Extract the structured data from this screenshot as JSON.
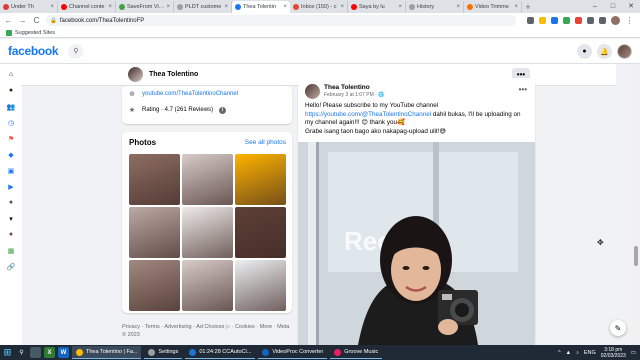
{
  "browser": {
    "tabs": [
      {
        "label": "Under Th",
        "color": "#e53935"
      },
      {
        "label": "Channel conte",
        "color": "#ff0000"
      },
      {
        "label": "SaveFrom Vide",
        "color": "#43a047"
      },
      {
        "label": "PLDT custome",
        "color": "#9e9e9e"
      },
      {
        "label": "Thea Tolentin",
        "color": "#1877f2",
        "active": true
      },
      {
        "label": "Inbox (150) - c",
        "color": "#ea4335"
      },
      {
        "label": "Saya by lu",
        "color": "#ff0000"
      },
      {
        "label": "History",
        "color": "#9e9e9e"
      },
      {
        "label": "Video Trimme",
        "color": "#ff6f00"
      }
    ],
    "tab_close": "×",
    "new_tab": "+",
    "win_min": "–",
    "win_max": "□",
    "win_close": "✕",
    "back": "←",
    "forward": "→",
    "reload": "C",
    "home": "⌂",
    "lock": "🔒",
    "url": "facebook.com/TheaTolentinoFP",
    "bookmark_label": "Suggested Sites"
  },
  "fb": {
    "logo": "facebook",
    "search_icon": "⚲",
    "messenger_icon": "●",
    "bell_icon": "🔔"
  },
  "rail_icons": [
    {
      "name": "home-icon",
      "glyph": "⌂",
      "color": "#050505"
    },
    {
      "name": "profile-icon",
      "glyph": "●",
      "color": "#3e2723"
    },
    {
      "name": "friends-icon",
      "glyph": "👥",
      "color": "#1877f2"
    },
    {
      "name": "memories-icon",
      "glyph": "◷",
      "color": "#1877f2"
    },
    {
      "name": "pages-icon",
      "glyph": "⚑",
      "color": "#f5533d"
    },
    {
      "name": "groups-icon",
      "glyph": "◆",
      "color": "#1877f2"
    },
    {
      "name": "gaming-icon",
      "glyph": "▣",
      "color": "#1877f2"
    },
    {
      "name": "watch-icon",
      "glyph": "▶",
      "color": "#1877f2"
    },
    {
      "name": "shortcut-icon",
      "glyph": "●",
      "color": "#455a64"
    },
    {
      "name": "more-icon",
      "glyph": "▾",
      "color": "#050505"
    },
    {
      "name": "shortcut-avatar-icon",
      "glyph": "●",
      "color": "#6d4c41"
    },
    {
      "name": "shortcut-photo-icon",
      "glyph": "▦",
      "color": "#43a047"
    },
    {
      "name": "link-icon",
      "glyph": "🔗",
      "color": "#65676b"
    }
  ],
  "profile": {
    "name": "Thea Tolentino",
    "more": "•••"
  },
  "intro": {
    "link_icon": "⊕",
    "youtube": "youtube.com/TheaTolentinoChannel",
    "star_icon": "★",
    "rating": "Rating · 4.7 (261 Reviews)",
    "info": "i"
  },
  "photos": {
    "title": "Photos",
    "see_all": "See all photos",
    "tiles": [
      "#8d6e63",
      "#d7ccc8",
      "#ffb300",
      "#bcaaa4",
      "#efebe9",
      "#5d4037",
      "#a1887f",
      "#d7ccc8",
      "#eceff1"
    ]
  },
  "footer": "Privacy · Terms · Advertising · Ad Choices ▷ · Cookies · More · Meta © 2023",
  "post": {
    "author": "Thea Tolentino",
    "date": "February 3 at 1:07 PM · 🌐",
    "dots": "•••",
    "line1": "Hello! Please subscribe to my YouTube channel",
    "link": "https://youtube.com/@TheaTolentinoChannel",
    "line2": " dahil bukas, I'll be uploading on my channel again!!! 😊 thank you🥰",
    "line3": "Grabe isang taon bago ako nakapag-upload ulit!😅",
    "watermark": "Reco"
  },
  "edit_icon": "✎",
  "cursor": "✥",
  "taskbar": {
    "start": "⊞",
    "search": "⚲",
    "items": [
      {
        "label": "Thea Tolentino | Fa...",
        "color": "#fbbc05",
        "active": true
      },
      {
        "label": "Settings",
        "color": "#9e9e9e"
      },
      {
        "label": "01:24:28 CCAutoCl...",
        "color": "#1976d2"
      },
      {
        "label": "VideoProc Converter",
        "color": "#1565c0"
      },
      {
        "label": "Groove Music",
        "color": "#e91e63"
      }
    ],
    "lang": "ENG",
    "time": "3:18 pm",
    "date": "02/03/2023"
  }
}
